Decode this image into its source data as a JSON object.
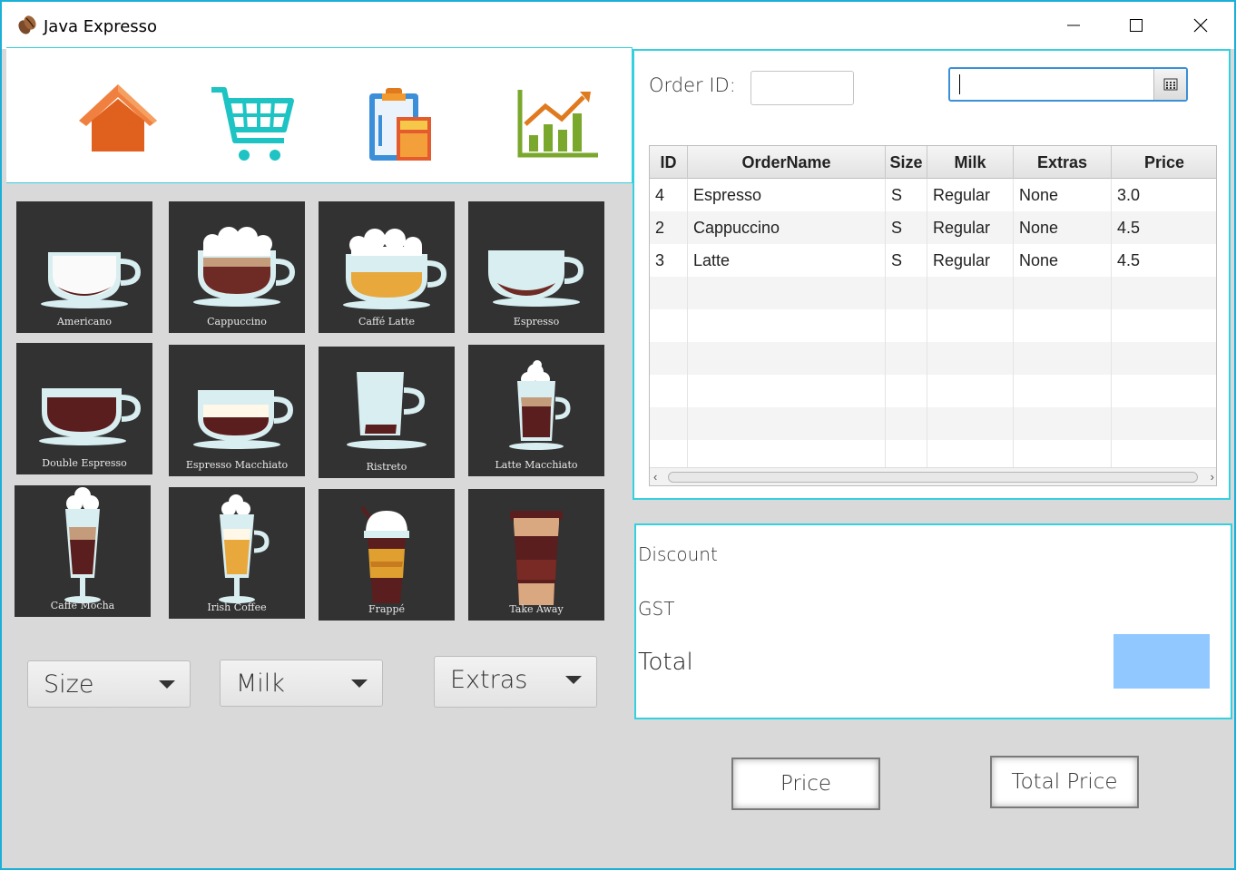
{
  "window": {
    "title": "Java Expresso"
  },
  "nav": {
    "icons": [
      "home-icon",
      "cart-icon",
      "clipboard-calculator-icon",
      "chart-growth-icon"
    ]
  },
  "menu": {
    "items": [
      "Americano",
      "Cappuccino",
      "Caffé Latte",
      "Espresso",
      "Double Espresso",
      "Espresso Macchiato",
      "Ristreto",
      "Latte Macchiato",
      "Caffé Mocha",
      "Irish Coffee",
      "Frappé",
      "Take Away"
    ]
  },
  "options": {
    "size": "Size",
    "milk": "Milk",
    "extras": "Extras"
  },
  "order": {
    "id_label": "Order ID:",
    "id_value": "",
    "date_value": "",
    "columns": [
      "ID",
      "OrderName",
      "Size",
      "Milk",
      "Extras",
      "Price"
    ],
    "rows": [
      [
        "4",
        "Espresso",
        "S",
        "Regular",
        "None",
        "3.0"
      ],
      [
        "2",
        "Cappuccino",
        "S",
        "Regular",
        "None",
        "4.5"
      ],
      [
        "3",
        "Latte",
        "S",
        "Regular",
        "None",
        "4.5"
      ]
    ]
  },
  "summary": {
    "discount": "Discount",
    "gst": "GST",
    "total": "Total",
    "total_value": ""
  },
  "buttons": {
    "price": "Price",
    "total_price": "Total Price"
  },
  "colors": {
    "accent_border": "#35d0e0",
    "total_box": "#90c8ff",
    "tile_bg": "#323232"
  }
}
